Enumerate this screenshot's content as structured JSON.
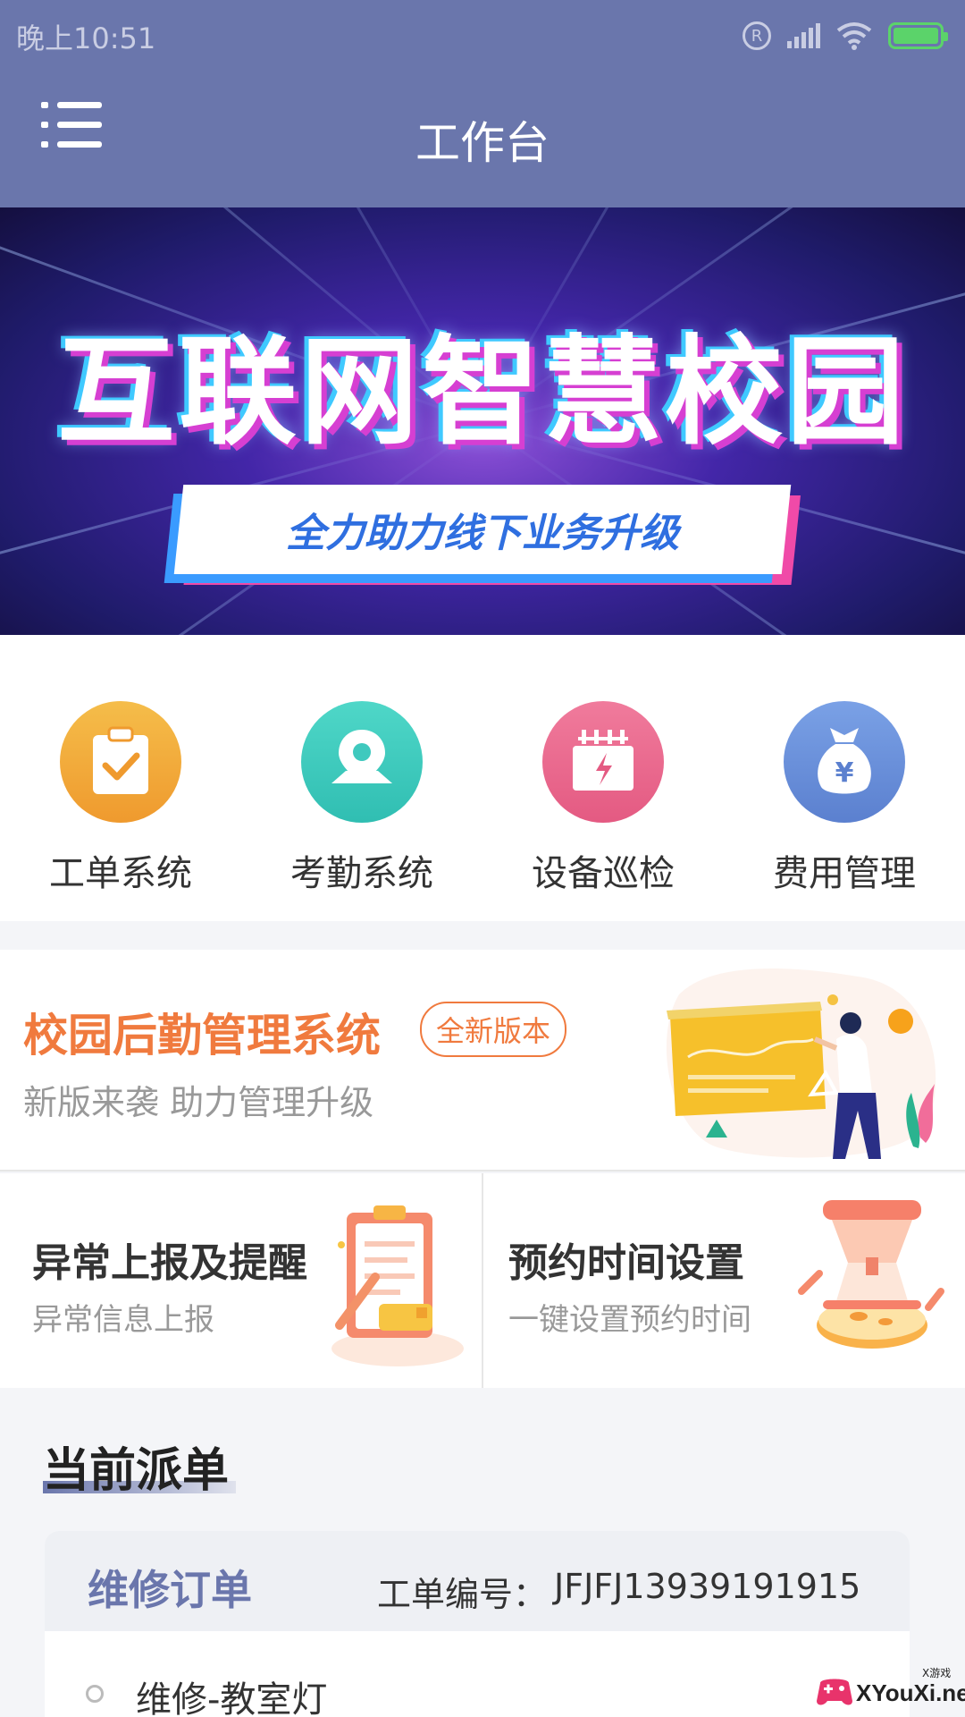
{
  "status_bar": {
    "time": "晚上10:51",
    "registered_symbol": "R"
  },
  "header": {
    "title": "工作台"
  },
  "banner": {
    "title": "互联网智慧校园",
    "subtitle": "全力助力线下业务升级"
  },
  "quick_access": [
    {
      "label": "工单系统",
      "icon": "clipboard-check-icon",
      "color": "#f2a73a"
    },
    {
      "label": "考勤系统",
      "icon": "map-pin-icon",
      "color": "#3fc9be"
    },
    {
      "label": "设备巡检",
      "icon": "transformer-icon",
      "color": "#e9698d"
    },
    {
      "label": "费用管理",
      "icon": "money-bag-icon",
      "color": "#6a8fd8",
      "symbol": "¥"
    }
  ],
  "promo": {
    "title": "校园后勤管理系统",
    "badge": "全新版本",
    "subtitle": "新版来袭 助力管理升级"
  },
  "cards": [
    {
      "title": "异常上报及提醒",
      "subtitle": "异常信息上报"
    },
    {
      "title": "预约时间设置",
      "subtitle": "一键设置预约时间"
    }
  ],
  "orders": {
    "section_title": "当前派单",
    "card": {
      "type": "维修订单",
      "number_label": "工单编号：",
      "number": "JFJFJ13939191915",
      "item": "维修-教室灯"
    }
  },
  "watermark": {
    "text": "XYouXi.net",
    "small": "X游戏"
  }
}
